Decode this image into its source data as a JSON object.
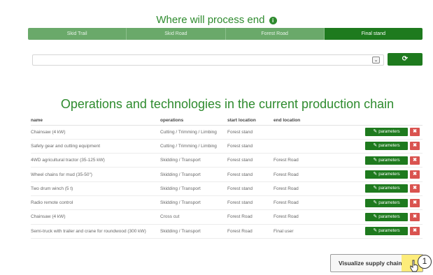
{
  "header": {
    "title": "Where will process end",
    "info_glyph": "i"
  },
  "steps": [
    {
      "label": "Skid Trail"
    },
    {
      "label": "Skid Road"
    },
    {
      "label": "Forest Road"
    },
    {
      "label": "Final stand"
    }
  ],
  "selector": {
    "value": "",
    "arrow_glyph": "⌄",
    "refresh_glyph": "⟳"
  },
  "section": {
    "heading": "Operations and technologies in the current production chain"
  },
  "table": {
    "columns": [
      "name",
      "operations",
      "start location",
      "end location"
    ],
    "rows": [
      {
        "name": "Chainsaw (4 kW)",
        "operations": "Cutting / Trimming / Limbing",
        "start": "Forest stand",
        "end": ""
      },
      {
        "name": "Safety gear and cutting equipment",
        "operations": "Cutting / Trimming / Limbing",
        "start": "Forest stand",
        "end": ""
      },
      {
        "name": "4WD agricultural tractor (35-125 kW)",
        "operations": "Skidding / Transport",
        "start": "Forest stand",
        "end": "Forest Road"
      },
      {
        "name": "Wheel chains for mud (35-50\")",
        "operations": "Skidding / Transport",
        "start": "Forest stand",
        "end": "Forest Road"
      },
      {
        "name": "Two drum winch (5 t)",
        "operations": "Skidding / Transport",
        "start": "Forest stand",
        "end": "Forest Road"
      },
      {
        "name": "Radio remote control",
        "operations": "Skidding / Transport",
        "start": "Forest stand",
        "end": "Forest Road"
      },
      {
        "name": "Chainsaw (4 kW)",
        "operations": "Cross cut",
        "start": "Forest Road",
        "end": "Forest Road"
      },
      {
        "name": "Semi-truck with trailer and crane for roundwood (300 kW)",
        "operations": "Skidding / Transport",
        "start": "Forest Road",
        "end": "Final user"
      }
    ],
    "param_label": "parameters",
    "delete_glyph": "✖"
  },
  "footer": {
    "visualize_label": "Visualize supply chain",
    "step_badge": "1"
  },
  "colors": {
    "primary_green": "#1e7a1e",
    "light_green": "#6aa96a",
    "danger_red": "#d9534f",
    "highlight_yellow": "#ffe850"
  }
}
